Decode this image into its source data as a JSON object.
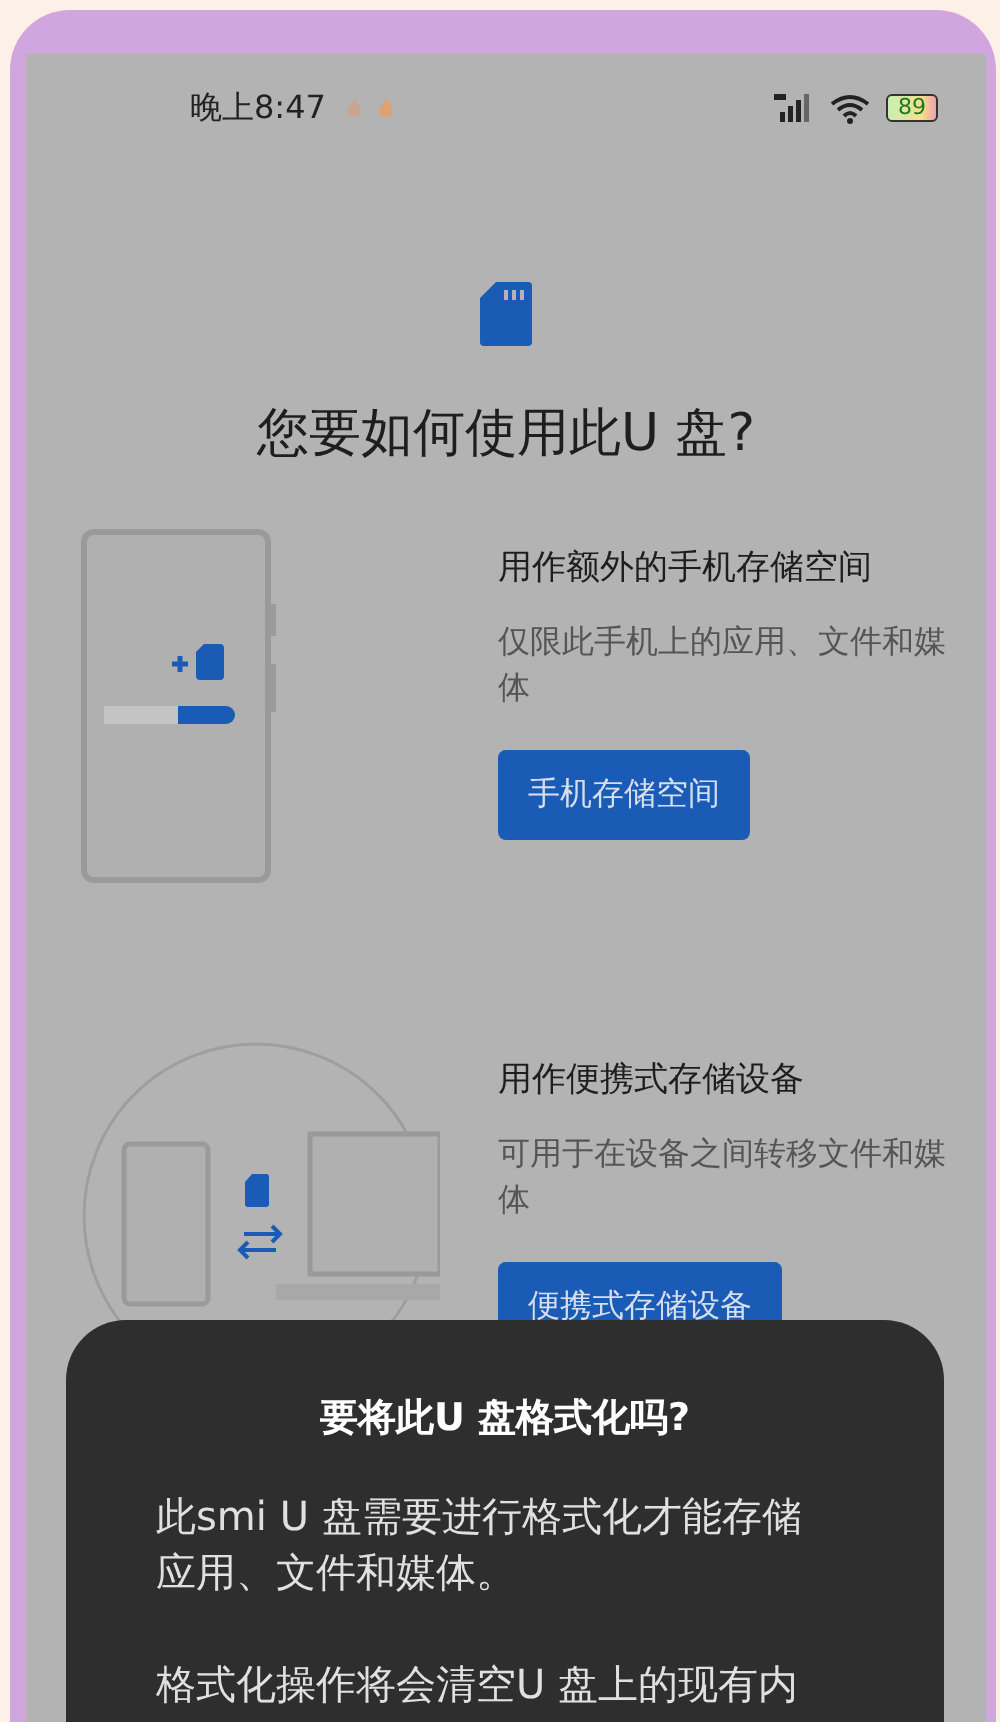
{
  "status_bar": {
    "time": "晚上8:47",
    "battery": "89"
  },
  "title": "您要如何使用此U 盘?",
  "options": [
    {
      "kind": "phone",
      "heading": "用作额外的手机存储空间",
      "description": "仅限此手机上的应用、文件和媒体",
      "button": "手机存储空间"
    },
    {
      "kind": "portable",
      "heading": "用作便携式存储设备",
      "description": "可用于在设备之间转移文件和媒体",
      "button": "便携式存储设备"
    }
  ],
  "dialog": {
    "title": "要将此U 盘格式化吗?",
    "paragraphs": [
      "此smi U 盘需要进行格式化才能存储应用、文件和媒体。",
      "格式化操作将会清空U 盘上的现有内"
    ]
  }
}
